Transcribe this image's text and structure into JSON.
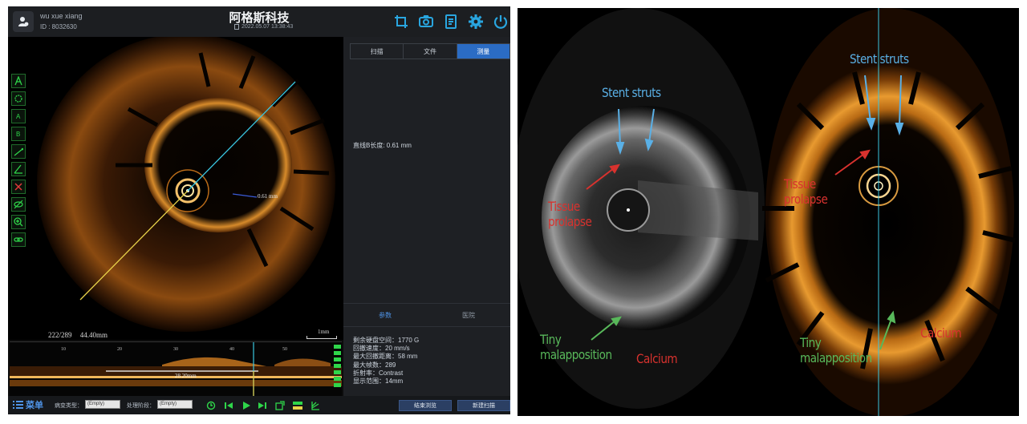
{
  "app": {
    "user": {
      "name": "wu xue xiang",
      "id": "ID : 8032630"
    },
    "title": "阿格斯科技",
    "datetime": "2022.05.07 13:38:43",
    "top_icons": [
      "crop-icon",
      "camera-icon",
      "report-icon",
      "settings-gear-icon",
      "power-icon"
    ],
    "accent_color": "#2b6cc4",
    "viewer": {
      "frame_info": "222/289",
      "pullback_length": "44.40mm",
      "measurement_label": "0.61 mm",
      "scale_label": "1mm",
      "long_view_measurement": "28.20mm",
      "long_view_ticks": [
        "10",
        "20",
        "30",
        "40",
        "50"
      ],
      "left_tools": [
        "area-auto-icon",
        "area-manual-icon",
        "point-a-icon",
        "point-b-icon",
        "line-measure-icon",
        "angle-icon",
        "delete-measure-icon",
        "hide-eye-icon",
        "zoom-in-icon",
        "link-icon"
      ]
    },
    "tabs": [
      "扫描",
      "文件",
      "测量"
    ],
    "active_tab": 2,
    "measurement_text": "直线B长度: 0.61 mm",
    "sub_tabs": [
      "参数",
      "医院"
    ],
    "active_sub_tab": 0,
    "params": [
      "剩余硬盘空间：1770 G",
      "回撤速度：20 mm/s",
      "最大回撤距离：58 mm",
      "最大帧数：289",
      "折射率：Contrast",
      "显示范围：14mm"
    ],
    "bottom": {
      "menu_label": "菜单",
      "lesion_type_label": "病变类型：",
      "lesion_type_value": "(Empty)",
      "stage_label": "处理阶段：",
      "stage_value": "(Empty)",
      "end_browse": "结束浏览",
      "new_scan": "新建扫描"
    }
  },
  "comparison": {
    "ivus": {
      "labels": {
        "stent": "Stent struts",
        "tissue1": "Tissue",
        "tissue2": "prolapse",
        "tiny1": "Tiny",
        "tiny2": "malapposition",
        "calcium": "Calcium"
      }
    },
    "oct": {
      "labels": {
        "stent": "Stent struts",
        "tissue1": "Tissue",
        "tissue2": "prolapse",
        "tiny1": "Tiny",
        "tiny2": "malapposition",
        "calcium": "Calcium"
      }
    },
    "colors": {
      "blue": "#5ab0e6",
      "red": "#d8322e",
      "green": "#58b85a"
    }
  }
}
